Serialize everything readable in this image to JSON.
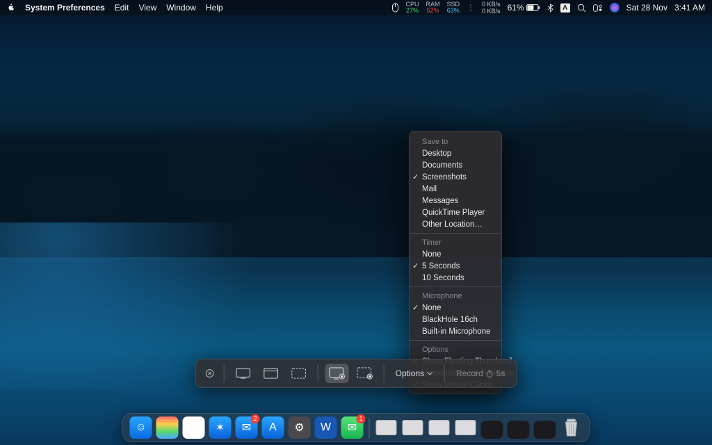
{
  "menubar": {
    "app_name": "System Preferences",
    "menus": [
      "Edit",
      "View",
      "Window",
      "Help"
    ],
    "stats": {
      "cpu": {
        "label": "CPU",
        "value": "27%"
      },
      "ram": {
        "label": "RAM",
        "value": "52%"
      },
      "ssd": {
        "label": "SSD",
        "value": "63%"
      }
    },
    "net_up": "0 KB/s",
    "net_down": "0 KB/s",
    "battery": "61%",
    "date": "Sat 28 Nov",
    "time": "3:41 AM"
  },
  "screenshot_toolbar": {
    "options_label": "Options",
    "record_label": "Record",
    "record_timer": "5s"
  },
  "options_menu": {
    "sections": [
      {
        "title": "Save to",
        "items": [
          {
            "label": "Desktop",
            "checked": false
          },
          {
            "label": "Documents",
            "checked": false
          },
          {
            "label": "Screenshots",
            "checked": true
          },
          {
            "label": "Mail",
            "checked": false
          },
          {
            "label": "Messages",
            "checked": false
          },
          {
            "label": "QuickTime Player",
            "checked": false
          },
          {
            "label": "Other Location…",
            "checked": false
          }
        ]
      },
      {
        "title": "Timer",
        "items": [
          {
            "label": "None",
            "checked": false
          },
          {
            "label": "5 Seconds",
            "checked": true
          },
          {
            "label": "10 Seconds",
            "checked": false
          }
        ]
      },
      {
        "title": "Microphone",
        "items": [
          {
            "label": "None",
            "checked": true
          },
          {
            "label": "BlackHole 16ch",
            "checked": false
          },
          {
            "label": "Built-in Microphone",
            "checked": false
          }
        ]
      },
      {
        "title": "Options",
        "items": [
          {
            "label": "Show Floating Thumbnail",
            "checked": true
          },
          {
            "label": "Remember Last Selection",
            "checked": false
          },
          {
            "label": "Show Mouse Clicks",
            "checked": true
          }
        ]
      }
    ]
  },
  "dock": {
    "apps": [
      {
        "name": "finder",
        "bg": "linear-gradient(#28a5ff,#0a6ae0)",
        "glyph": "☺"
      },
      {
        "name": "launchpad",
        "bg": "linear-gradient(#ff6a6a,#ffcc4d,#59d96a,#4aa8ff)",
        "glyph": ""
      },
      {
        "name": "chrome",
        "bg": "#fff",
        "glyph": "◉"
      },
      {
        "name": "safari",
        "bg": "linear-gradient(#2aa7ff,#0a62d8)",
        "glyph": "✶"
      },
      {
        "name": "mail",
        "bg": "linear-gradient(#2aa7ff,#0a62d8)",
        "glyph": "✉",
        "badge": "2"
      },
      {
        "name": "app-store",
        "bg": "linear-gradient(#2aa7ff,#0a62d8)",
        "glyph": "A"
      },
      {
        "name": "settings",
        "bg": "#4a4a4e",
        "glyph": "⚙"
      },
      {
        "name": "word",
        "bg": "#1857b5",
        "glyph": "W"
      },
      {
        "name": "messages",
        "bg": "linear-gradient(#55e27a,#18b552)",
        "glyph": "✉",
        "badge": "1"
      }
    ],
    "right": [
      {
        "name": "folder-1"
      },
      {
        "name": "folder-2"
      },
      {
        "name": "folder-3"
      },
      {
        "name": "folder-4"
      },
      {
        "name": "dark-tile-1"
      },
      {
        "name": "dark-tile-2"
      },
      {
        "name": "dark-tile-3"
      },
      {
        "name": "trash"
      }
    ]
  }
}
